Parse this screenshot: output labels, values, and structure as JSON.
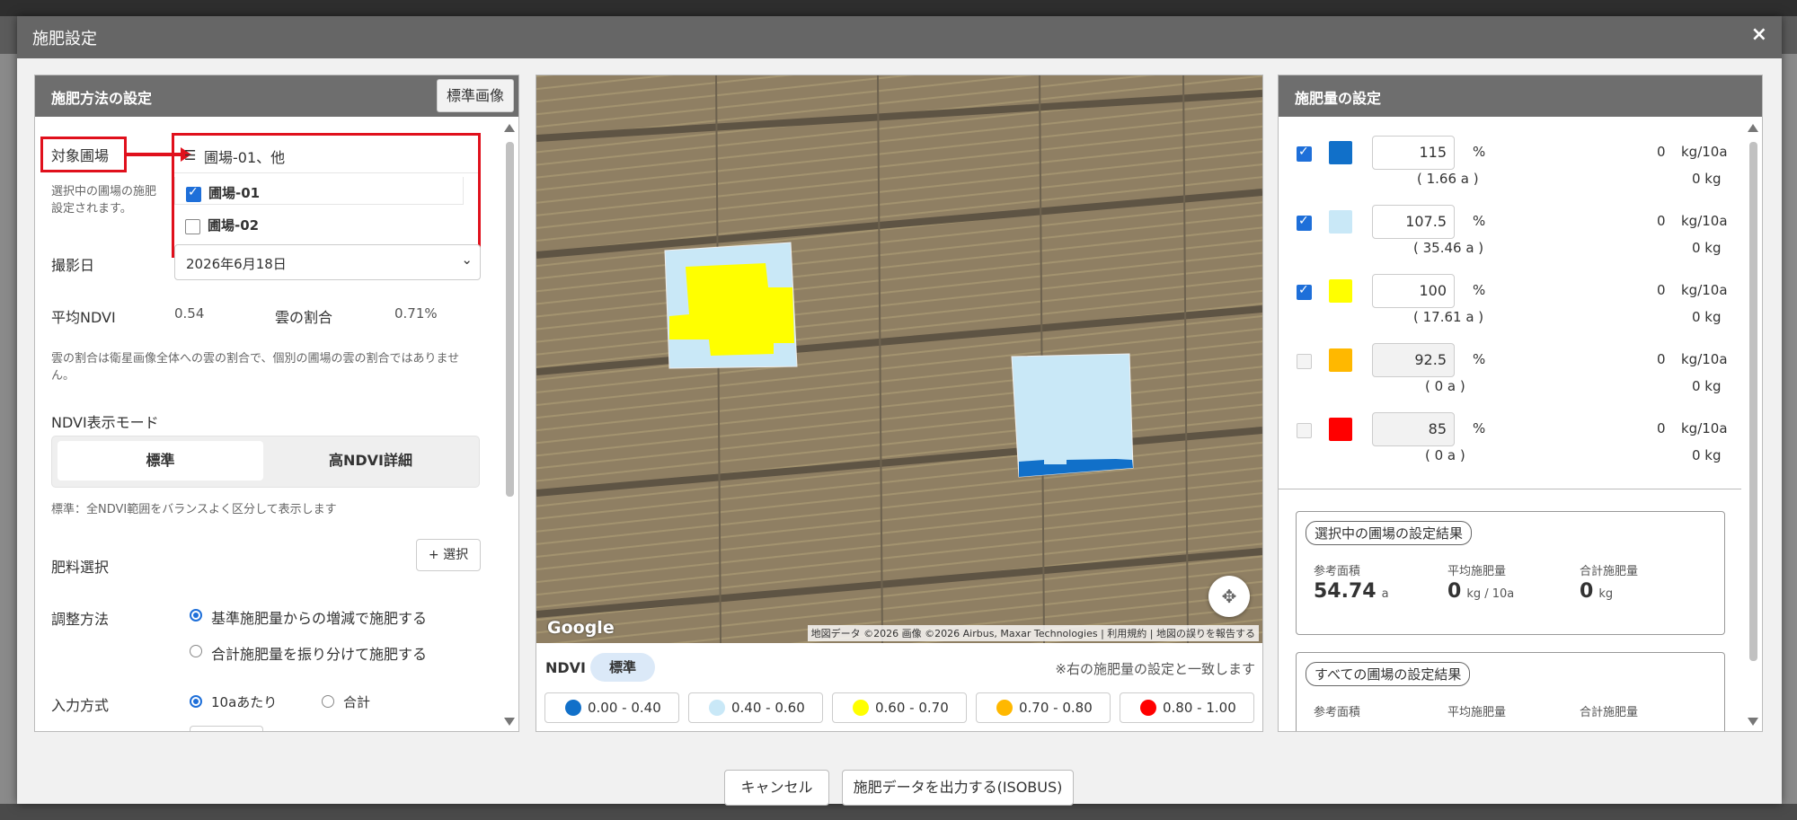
{
  "modal": {
    "title": "施肥設定",
    "close": "×"
  },
  "left": {
    "title": "施肥方法の設定",
    "std_image_btn": "標準画像",
    "target_label": "対象圃場",
    "target_value": "圃場-01、他",
    "fields": [
      {
        "label": "圃場-01",
        "checked": true
      },
      {
        "label": "圃場-02",
        "checked": false
      }
    ],
    "target_note_1": "選択中の圃場の施肥",
    "target_note_2": "設定されます。",
    "date_label": "撮影日",
    "date_value": "2026年6月18日",
    "avg_ndvi_label": "平均NDVI",
    "avg_ndvi_value": "0.54",
    "cloud_label": "雲の割合",
    "cloud_value": "0.71%",
    "cloud_note": "雲の割合は衛星画像全体への雲の割合で、個別の圃場の雲の割合ではありません。",
    "ndvi_mode_label": "NDVI表示モード",
    "mode_standard": "標準",
    "mode_high": "高NDVI詳細",
    "mode_note": "標準：全NDVI範囲をバランスよく区分して表示します",
    "fert_label": "肥料選択",
    "fert_btn": "+ 選択",
    "adjust_label": "調整方法",
    "adjust_opt1": "基準施肥量からの増減で施肥する",
    "adjust_opt2": "合計施肥量を振り分けて施肥する",
    "input_label": "入力方式",
    "input_opt1": "10aあたり",
    "input_opt2": "合計"
  },
  "map": {
    "google": "Google",
    "credit": "地図データ ©2026 画像 ©2026 Airbus, Maxar Technologies | 利用規約 | 地図の誤りを報告する",
    "ndvi_label": "NDVI",
    "ndvi_mode": "標準",
    "note": "※右の施肥量の設定と一致します",
    "legend": [
      {
        "range": "0.00 - 0.40",
        "color": "#1170c9"
      },
      {
        "range": "0.40 - 0.60",
        "color": "#c9e8f7"
      },
      {
        "range": "0.60 - 0.70",
        "color": "#ffff00"
      },
      {
        "range": "0.70 - 0.80",
        "color": "#ffb800"
      },
      {
        "range": "0.80 - 1.00",
        "color": "#ff0000"
      }
    ]
  },
  "right": {
    "title": "施肥量の設定",
    "rows": [
      {
        "checked": true,
        "color": "#1170c9",
        "rate": "115",
        "pct": "%",
        "amount": "0",
        "unit": "kg/10a",
        "area": "( 1.66 a )",
        "total": "0 kg"
      },
      {
        "checked": true,
        "color": "#c9e8f7",
        "rate": "107.5",
        "pct": "%",
        "amount": "0",
        "unit": "kg/10a",
        "area": "( 35.46 a )",
        "total": "0 kg"
      },
      {
        "checked": true,
        "color": "#ffff00",
        "rate": "100",
        "pct": "%",
        "amount": "0",
        "unit": "kg/10a",
        "area": "( 17.61 a )",
        "total": "0 kg"
      },
      {
        "checked": false,
        "color": "#ffb800",
        "rate": "92.5",
        "pct": "%",
        "amount": "0",
        "unit": "kg/10a",
        "area": "( 0 a )",
        "total": "0 kg"
      },
      {
        "checked": false,
        "color": "#ff0000",
        "rate": "85",
        "pct": "%",
        "amount": "0",
        "unit": "kg/10a",
        "area": "( 0 a )",
        "total": "0 kg"
      }
    ],
    "selected_result": {
      "title": "選択中の圃場の設定結果",
      "area_label": "参考面積",
      "area_value": "54.74",
      "area_unit": "a",
      "avg_label": "平均施肥量",
      "avg_value": "0",
      "avg_unit": "kg / 10a",
      "sum_label": "合計施肥量",
      "sum_value": "0",
      "sum_unit": "kg"
    },
    "all_result": {
      "title": "すべての圃場の設定結果",
      "area_label": "参考面積",
      "avg_label": "平均施肥量",
      "sum_label": "合計施肥量"
    }
  },
  "footer": {
    "cancel": "キャンセル",
    "export": "施肥データを出力する(ISOBUS)"
  }
}
